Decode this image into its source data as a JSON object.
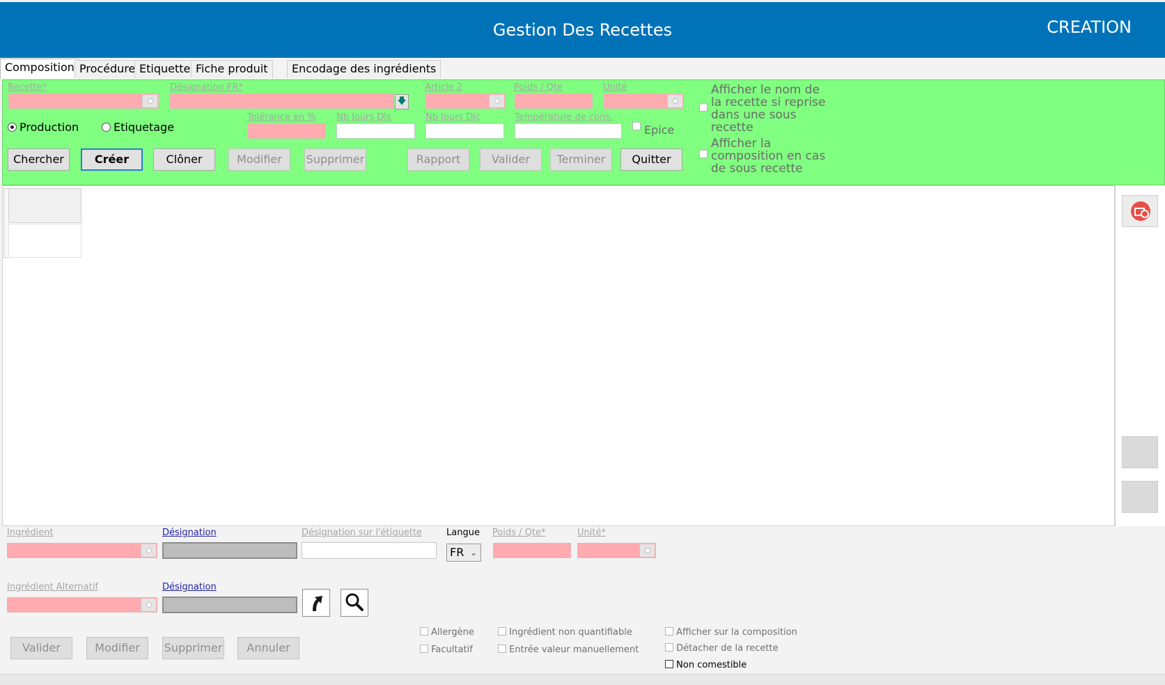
{
  "header": {
    "title": "Gestion Des Recettes",
    "mode": "CREATION"
  },
  "tabs": [
    {
      "label": "Composition",
      "active": true
    },
    {
      "label": "Procédure"
    },
    {
      "label": "Etiquette"
    },
    {
      "label": "Fiche produit"
    },
    {
      "label": "Encodage des ingrédients"
    }
  ],
  "form": {
    "recette_label": "Recette*",
    "designation_fr_label": "Désignation FR*",
    "article2_label": "Article 2",
    "poids_qte_label": "Poids / Qte",
    "unite_label": "Unité",
    "tolerance_label": "Tolérance en %",
    "nb_jours_dls_label": "Nb Jours Dls",
    "nb_jours_dlc_label": "Nb Jours Dlc",
    "temperature_label": "Température de cons.",
    "epice_label": "Epice",
    "radio_production": "Production",
    "radio_etiquetage": "Etiquetage",
    "selected_mode": "Production",
    "option_nom_recette": [
      "Afficher le nom de",
      "la recette si reprise",
      "dans une sous",
      "recette"
    ],
    "option_composition": [
      "Afficher la",
      "composition en cas",
      "de sous recette"
    ]
  },
  "actions": {
    "chercher": "Chercher",
    "creer": "Créer",
    "cloner": "Clôner",
    "modifier": "Modifier",
    "supprimer": "Supprimer",
    "rapport": "Rapport",
    "valider": "Valider",
    "terminer": "Terminer",
    "quitter": "Quitter"
  },
  "ingredient": {
    "ingredient_label": "Ingrédient",
    "designation_label": "Désignation",
    "designation_etiquette_label": "Désignation sur l'étiquette",
    "langue_label": "Langue",
    "langue_value": "FR",
    "poids_qte_label": "Poids / Qte*",
    "unite_label": "Unité*",
    "alternatif_label": "Ingrédient Alternatif",
    "alt_designation_label": "Désignation"
  },
  "options": {
    "allergene": "Allergène",
    "facultatif": "Facultatif",
    "non_quantifiable": "Ingrédient non quantifiable",
    "entree_manuelle": "Entrée valeur manuellement",
    "afficher_composition": "Afficher sur la composition",
    "detacher": "Détacher de la recette",
    "non_comestible": "Non comestible"
  },
  "bottom_actions": {
    "valider": "Valider",
    "modifier": "Modifier",
    "supprimer": "Supprimer",
    "annuler": "Annuler"
  },
  "colors": {
    "header": "#0073b8",
    "form_bg": "#80ff80",
    "required_field": "#ffabb0",
    "readonly_field": "#bdbdbd"
  }
}
